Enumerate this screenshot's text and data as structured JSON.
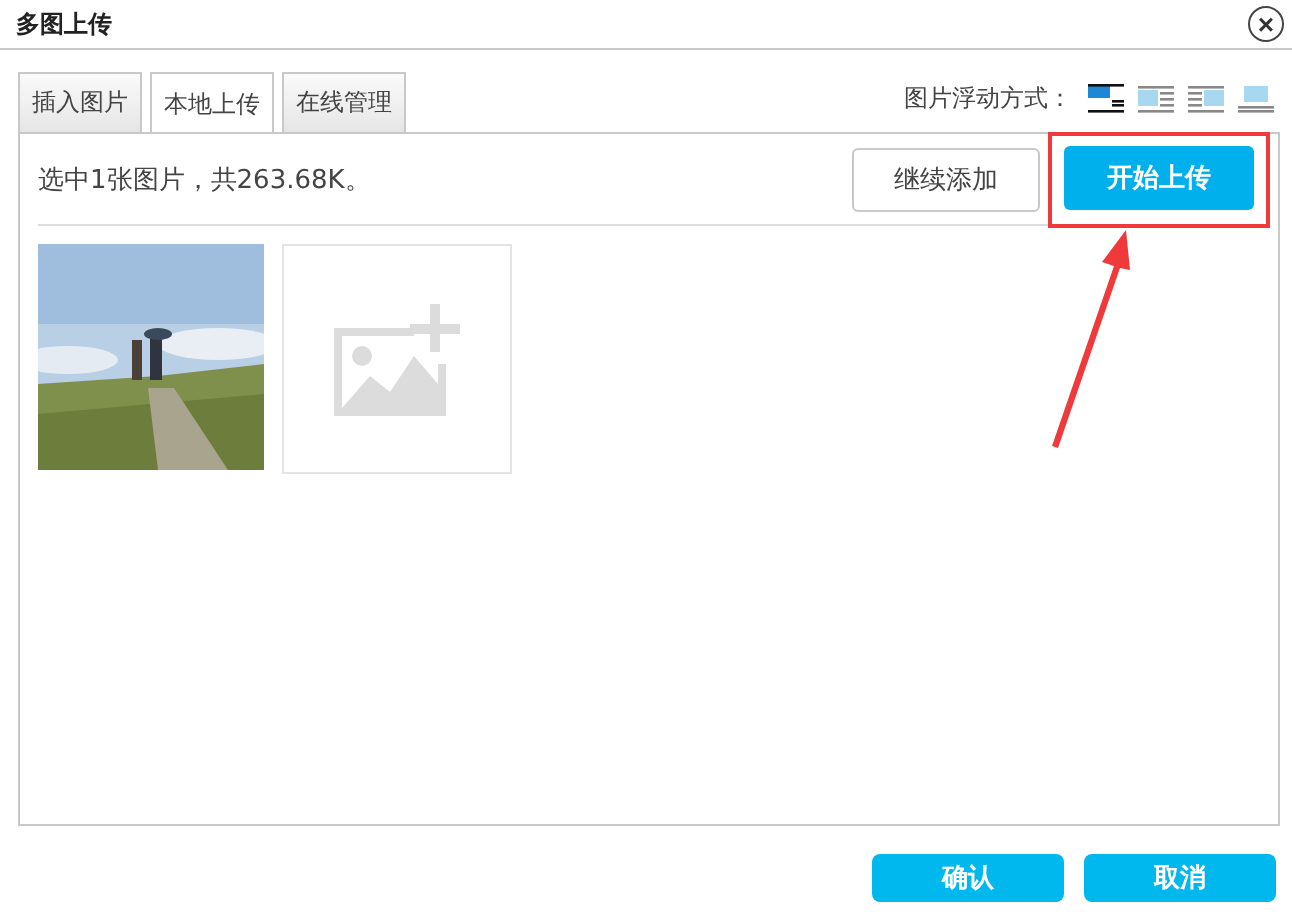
{
  "window": {
    "title": "多图上传",
    "close_glyph": "×"
  },
  "tabs": [
    {
      "label": "插入图片",
      "selected": false
    },
    {
      "label": "本地上传",
      "selected": true
    },
    {
      "label": "在线管理",
      "selected": false
    }
  ],
  "float_mode": {
    "label": "图片浮动方式：",
    "options": [
      {
        "kind": "none",
        "selected": true
      },
      {
        "kind": "left",
        "selected": false
      },
      {
        "kind": "right",
        "selected": false
      },
      {
        "kind": "center",
        "selected": false
      }
    ]
  },
  "status": "选中1张图片，共263.68K。",
  "add_more_button": "继续添加",
  "start_upload_button": "开始上传",
  "thumbnails": [
    {
      "kind": "picture"
    },
    {
      "kind": "add"
    }
  ],
  "buttons": [
    "确认",
    "取消"
  ]
}
